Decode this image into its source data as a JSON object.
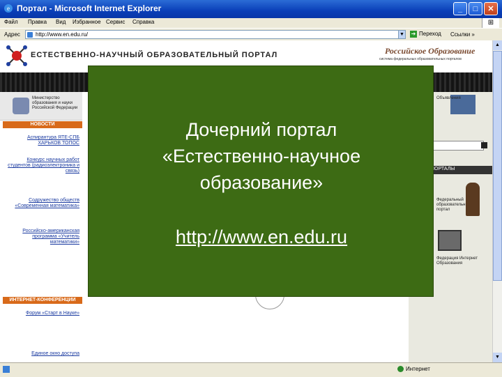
{
  "window": {
    "title": "Портал - Microsoft Internet Explorer",
    "min_label": "_",
    "max_label": "□",
    "close_label": "✕"
  },
  "menu": {
    "items": [
      "Файл",
      "Правка",
      "Вид",
      "Избранное",
      "Сервис",
      "Справка"
    ]
  },
  "address": {
    "label": "Адрес",
    "url": "http://www.en.edu.ru/",
    "go_label": "Переход",
    "links_label": "Ссылки »"
  },
  "portal": {
    "title": "ЕСТЕСТВЕННО-НАУЧНЫЙ ОБРАЗОВАТЕЛЬНЫЙ ПОРТАЛ",
    "ro_logo": "Российское Образование",
    "ro_sub": "система федеральных образовательных порталов",
    "ministry": "Министерство образования и науки Российской Федерации",
    "news_header": "НОВОСТИ",
    "news": [
      "Аспирантура ЯТЕ-СПБ ХАРЬКОВ ТОПОС",
      "Конкурс научных работ студентов (радиоэлектроника и связь)",
      "Содружество обществ «Современная математика»",
      "Российско-американская программа «Учитель математики»"
    ],
    "conf_header": "ИНТЕРНЕТ-КОНФЕРЕНЦИИ",
    "conf_links": [
      "Форум «Старт в Науке»",
      "Единое окно доступа"
    ],
    "right_texts": [
      "Объявления",
      "Федеральный образовательный портал",
      "Федерация Интернет Образования"
    ],
    "right_bar": "ПОРТАЛЫ"
  },
  "overlay": {
    "title": "Дочерний портал\n«Естественно-научное\nобразование»",
    "url": "http://www.en.edu.ru"
  },
  "status": {
    "zone": "Интернет"
  }
}
